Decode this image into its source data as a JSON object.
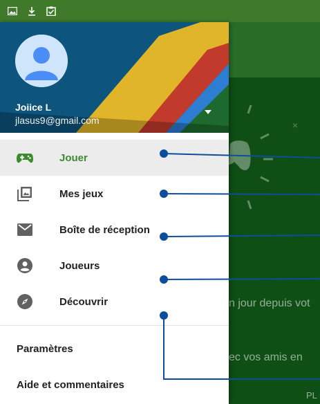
{
  "status_bar": {
    "icons": [
      "image-icon",
      "download-icon",
      "clipboard-check-icon"
    ]
  },
  "drawer": {
    "user": {
      "name": "Joiice L",
      "email": "jlasus9@gmail.com"
    },
    "menu": [
      {
        "label": "Jouer",
        "icon": "gamepad-icon",
        "active": true
      },
      {
        "label": "Mes jeux",
        "icon": "games-library-icon",
        "active": false
      },
      {
        "label": "Boîte de réception",
        "icon": "mail-icon",
        "active": false
      },
      {
        "label": "Joueurs",
        "icon": "person-icon",
        "active": false
      },
      {
        "label": "Découvrir",
        "icon": "compass-icon",
        "active": false
      }
    ],
    "footer": [
      {
        "label": "Paramètres"
      },
      {
        "label": "Aide et commentaires"
      }
    ]
  },
  "background_app": {
    "text_1": "n jour depuis vot",
    "text_2": "ec vos amis en",
    "text_3": "PL"
  },
  "colors": {
    "status_bar": "#3f7a2b",
    "active_green": "#3d8b2f",
    "callout_blue": "#0d4d9c"
  }
}
